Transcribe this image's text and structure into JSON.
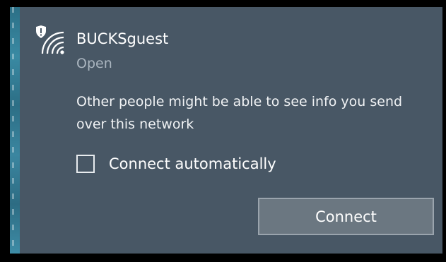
{
  "network": {
    "ssid": "BUCKSguest",
    "security": "Open",
    "warning": "Other people might be able to see info you send over this network",
    "icon": "wifi-shield-icon"
  },
  "options": {
    "connect_automatically_label": "Connect automatically",
    "connect_automatically_checked": false
  },
  "actions": {
    "connect_label": "Connect"
  },
  "colors": {
    "panel_background": "#485765",
    "button_background": "#6b7781",
    "secondary_text": "#aab5bf"
  }
}
